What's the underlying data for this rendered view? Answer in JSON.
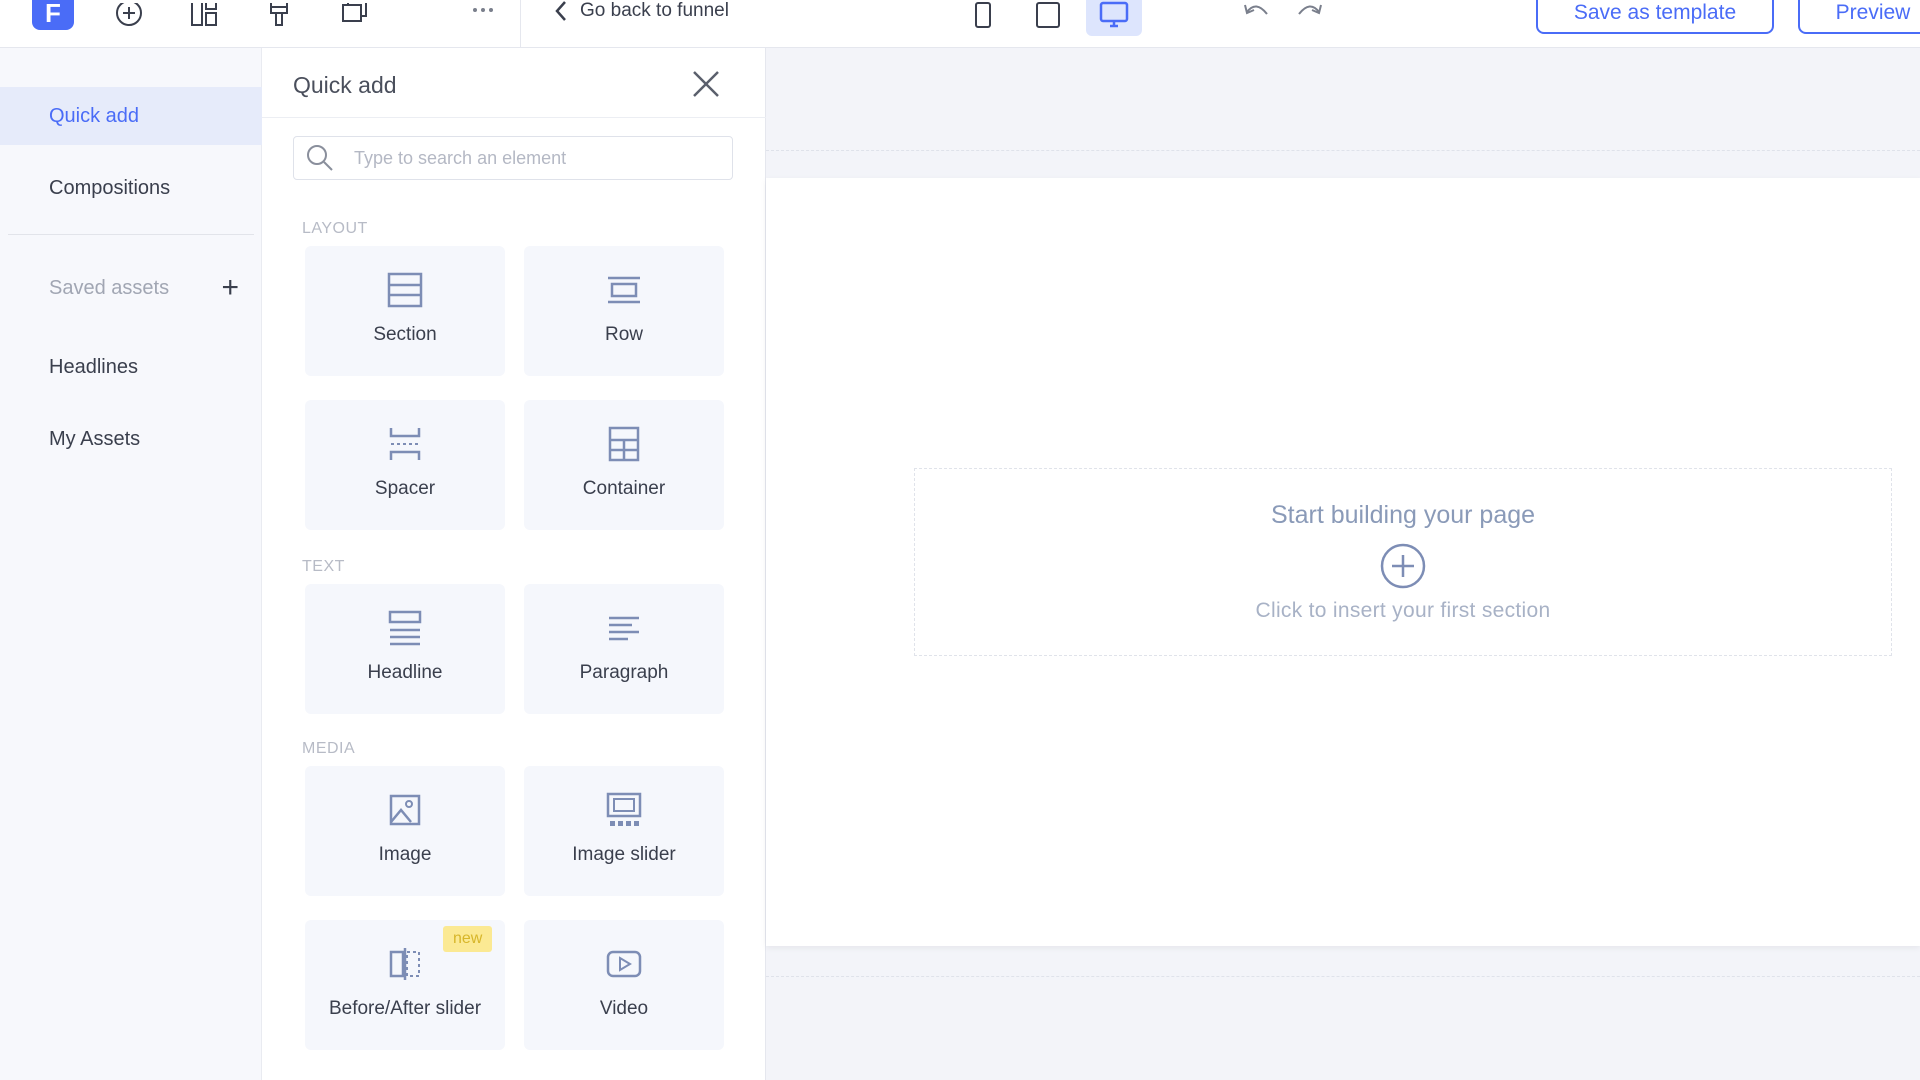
{
  "topbar": {
    "logo_letter": "F",
    "go_back_label": "Go back to funnel",
    "save_template_label": "Save as template",
    "preview_label": "Preview",
    "accent_color": "#4a6cf7"
  },
  "leftnav": {
    "items": [
      {
        "label": "Quick add",
        "active": true
      },
      {
        "label": "Compositions",
        "active": false
      }
    ],
    "saved_assets_label": "Saved assets",
    "saved_assets_plus": "+",
    "asset_items": [
      {
        "label": "Headlines"
      },
      {
        "label": "My Assets"
      }
    ]
  },
  "panel": {
    "title": "Quick add",
    "search_placeholder": "Type to search an element",
    "categories": {
      "layout": "LAYOUT",
      "text": "TEXT",
      "media": "MEDIA"
    },
    "tiles": {
      "section": "Section",
      "row": "Row",
      "spacer": "Spacer",
      "container": "Container",
      "headline": "Headline",
      "paragraph": "Paragraph",
      "image": "Image",
      "image_slider": "Image slider",
      "before_after": "Before/After slider",
      "video": "Video"
    },
    "new_badge": "new"
  },
  "canvas": {
    "empty_title": "Start building your page",
    "empty_subtitle": "Click to insert your first section"
  }
}
